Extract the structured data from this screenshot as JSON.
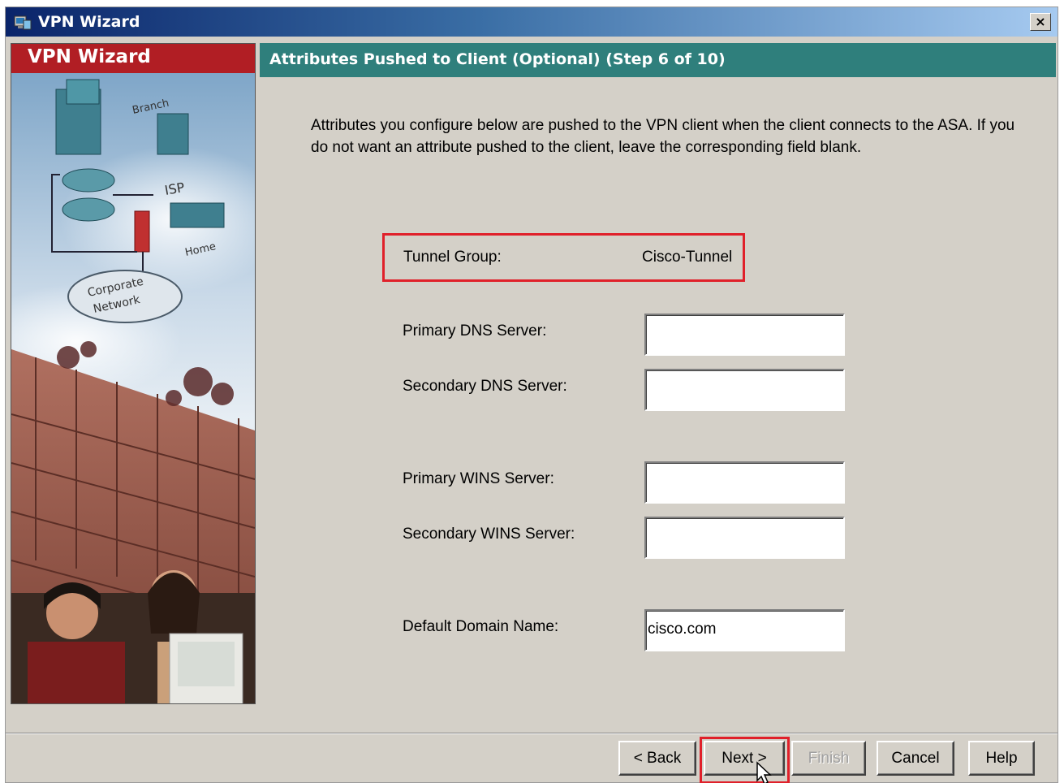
{
  "window": {
    "title": "VPN Wizard",
    "close_label": "×"
  },
  "left_panel": {
    "header": "VPN Wizard",
    "art_labels": {
      "branch": "Branch",
      "isp": "ISP",
      "home": "Home",
      "corporate": "Corporate",
      "network": "Network"
    }
  },
  "step_header": "Attributes Pushed to Client (Optional)  (Step 6 of 10)",
  "intro_text": "Attributes you configure below are pushed to the VPN client when the client connects to the ASA. If you do not want an attribute pushed to the client, leave the corresponding field blank.",
  "form": {
    "tunnel_group_label": "Tunnel Group:",
    "tunnel_group_value": "Cisco-Tunnel",
    "primary_dns_label": "Primary DNS Server:",
    "primary_dns_value": "",
    "secondary_dns_label": "Secondary DNS Server:",
    "secondary_dns_value": "",
    "primary_wins_label": "Primary WINS Server:",
    "primary_wins_value": "",
    "secondary_wins_label": "Secondary WINS Server:",
    "secondary_wins_value": "",
    "domain_label": "Default Domain Name:",
    "domain_value": "cisco.com"
  },
  "buttons": {
    "back": "< Back",
    "next": "Next >",
    "finish": "Finish",
    "cancel": "Cancel",
    "help": "Help"
  },
  "colors": {
    "title_bar_start": "#0a246a",
    "step_bar": "#2f7f7c",
    "left_header": "#b11e24",
    "highlight": "#e0202a",
    "dialog_bg": "#d4d0c8"
  }
}
